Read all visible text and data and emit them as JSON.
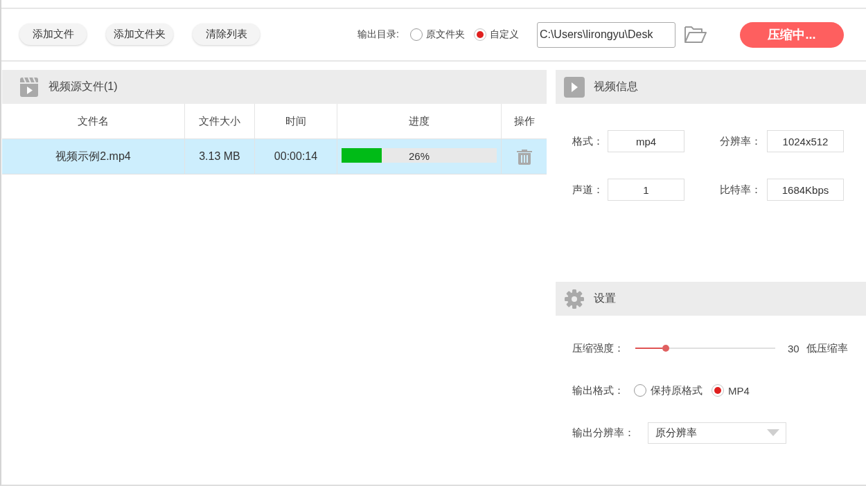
{
  "toolbar": {
    "buttons": [
      {
        "label": "添加文件"
      },
      {
        "label": "添加文件夹"
      },
      {
        "label": "清除列表"
      }
    ],
    "output_dir": {
      "label": "输出目录:",
      "options": [
        {
          "label": "原文件夹",
          "selected": false
        },
        {
          "label": "自定义",
          "selected": true
        }
      ],
      "path": "C:\\Users\\lirongyu\\Desk"
    },
    "compress_button": "压缩中..."
  },
  "file_panel": {
    "title": "视频源文件(1)",
    "columns": [
      "文件名",
      "文件大小",
      "时间",
      "进度",
      "操作"
    ],
    "rows": [
      {
        "name": "视频示例2.mp4",
        "size": "3.13 MB",
        "time": "00:00:14",
        "progress": {
          "level": 0.26,
          "text": "26%"
        },
        "selected": true
      }
    ]
  },
  "info_panel": {
    "title": "视频信息",
    "fields": [
      {
        "label": "格式：",
        "value": "mp4"
      },
      {
        "label": "分辨率：",
        "value": "1024x512"
      },
      {
        "label": "声道：",
        "value": "1"
      },
      {
        "label": "比特率：",
        "value": "1684Kbps"
      }
    ]
  },
  "settings_panel": {
    "title": "设置",
    "compression": {
      "label": "压缩强度：",
      "level": 0.22,
      "value": "30",
      "description": "低压缩率"
    },
    "output_format": {
      "label": "输出格式：",
      "options": [
        {
          "label": "保持原格式",
          "selected": false
        },
        {
          "label": "MP4",
          "selected": true
        }
      ]
    },
    "output_resolution": {
      "label": "输出分辨率：",
      "value": "原分辨率"
    }
  }
}
